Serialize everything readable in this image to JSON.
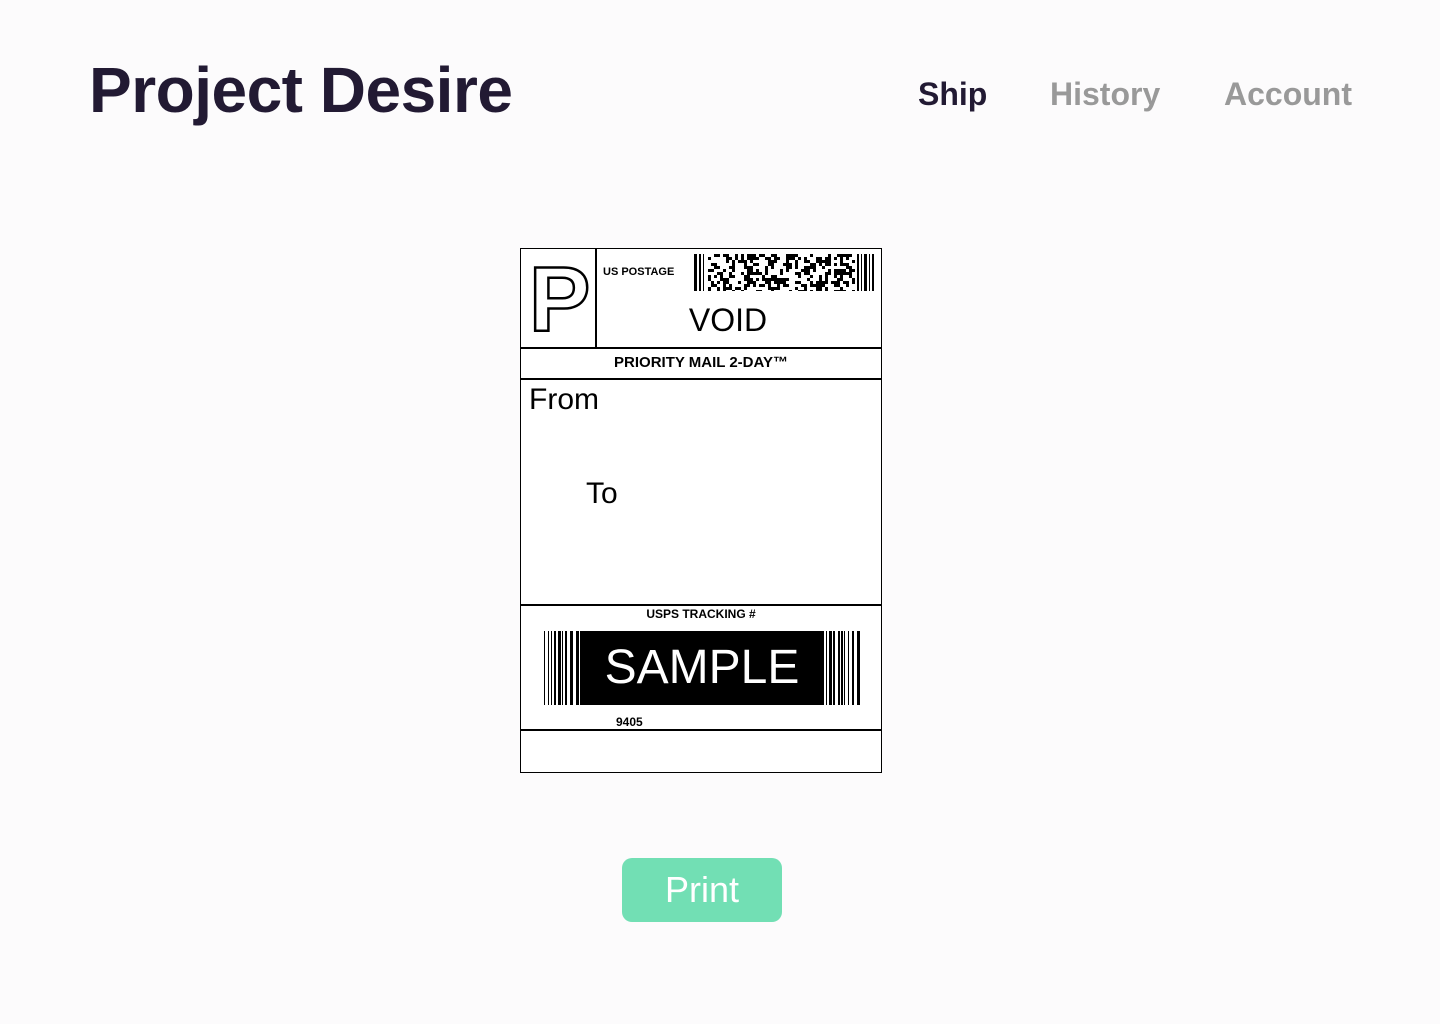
{
  "header": {
    "brand": "Project Desire",
    "nav": [
      {
        "label": "Ship",
        "active": true
      },
      {
        "label": "History",
        "active": false
      },
      {
        "label": "Account",
        "active": false
      }
    ]
  },
  "label": {
    "logo_letter": "P",
    "postage_text": "US POSTAGE",
    "void_text": "VOID",
    "service": "PRIORITY MAIL 2-DAY™",
    "from_label": "From",
    "to_label": "To",
    "tracking_title": "USPS TRACKING #",
    "barcode_overlay": "SAMPLE",
    "tracking_number": "9405"
  },
  "actions": {
    "print_label": "Print"
  },
  "colors": {
    "brand": "#221a33",
    "nav_inactive": "#999999",
    "print_button": "#72dfb4",
    "background": "#fcfbfc"
  }
}
